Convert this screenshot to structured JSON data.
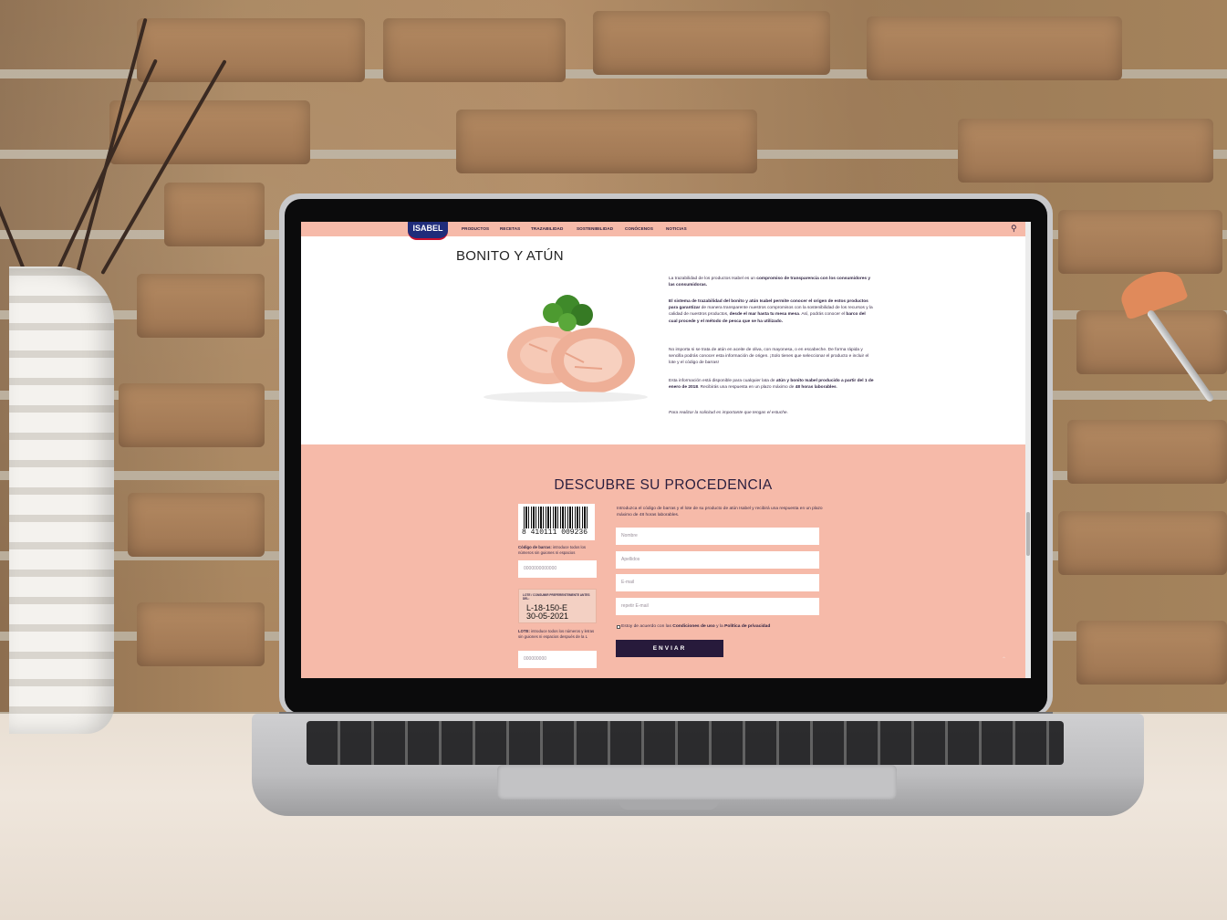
{
  "nav": {
    "logo": "ISABEL",
    "items": [
      "PRODUCTOS",
      "RECETAS",
      "TRAZABILIDAD",
      "SOSTENIBILIDAD",
      "CONÓCENOS",
      "NOTICIAS"
    ],
    "search_icon": "search-icon"
  },
  "hero": {
    "title": "BONITO Y ATÚN",
    "p1": [
      "La trazabilidad de los productos Isabel es un ",
      "compromiso de transparencia con los consumidores y las consumidoras."
    ],
    "p2": [
      "El sistema de trazabilidad del bonito y atún Isabel permite conocer el origen de estos productos para garantizar",
      " de manera transparente  nuestros compromisos con la sostenibilidad de los recursos y la calidad de nuestros productos, ",
      "desde el mar hasta tu mesa mesa",
      ". Así, podrás conocer el ",
      "barco del cual procede y el método de pesca que se ha utilizado."
    ],
    "p3": "No importa si se trata de atún en aceite de oliva, con mayonesa, o en escabeche. De forma rápida y sencilla podrás conocer esta información de origen. ¡Solo tienes que seleccionar el producto e incluir el lote y el código de barras!",
    "p4": [
      "Esta información está disponible para cualquier lata de ",
      "atún y bonito Isabel producido a partir del 1 de enero de 2018",
      ". Recibirás una respuesta en un plazo máximo de ",
      "48 horas laborables",
      "."
    ],
    "p5": "Para realizar la solicitud es importante que tengas el estuche."
  },
  "form": {
    "heading": "DESCUBRE SU PROCEDENCIA",
    "barcode_number": "8  410111  009236",
    "barcode_help": [
      "Código de barras:",
      " introduce todos los números sin guiones ni espacios"
    ],
    "barcode_placeholder": "0000000000000",
    "lot_label": "LOTE / CONSUMIR PREFERENTEMENTE ANTES DEL:",
    "lot_line1": "L-18-150-E",
    "lot_line2": "30-05-2021",
    "lot_help": [
      "LOTE:",
      " introduce todos los números y letras sin guiones ni espacios después de la L"
    ],
    "lot_placeholder": "000000000",
    "intro": "Introduzca el código de barras y el lote de su producto de atún Isabel y recibirá una respuesta en un plazo máximo de 48 horas laborables.",
    "fields": [
      "Nombre",
      "Apellidos",
      "E-mail",
      "repetir E-mail"
    ],
    "agree": [
      "Estoy de acuerdo con las ",
      "Condiciones de uso",
      " y la ",
      "Política de privacidad"
    ],
    "submit": "ENVIAR",
    "to_top_icon": "chevron-up-icon"
  },
  "colors": {
    "accent_pink": "#f6baa9",
    "navy": "#271a3b",
    "logo_blue": "#1f2c7a"
  }
}
